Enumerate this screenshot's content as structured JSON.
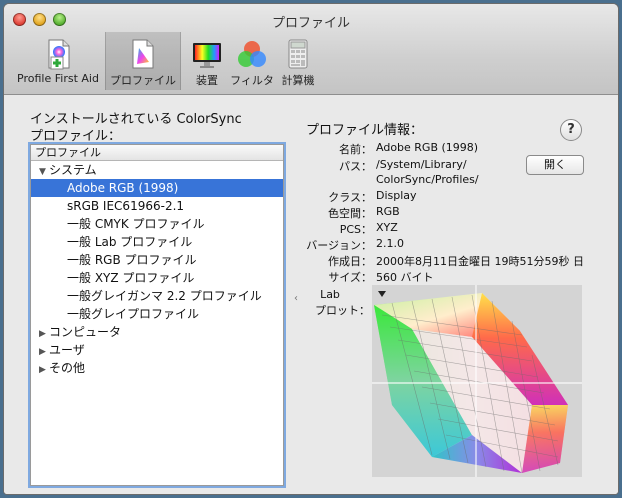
{
  "window": {
    "title": "プロファイル"
  },
  "toolbar": {
    "items": [
      {
        "label": "Profile First Aid",
        "icon": "profile-first-aid-icon"
      },
      {
        "label": "プロファイル",
        "icon": "profile-document-icon",
        "selected": true
      },
      {
        "label": "装置",
        "icon": "display-icon"
      },
      {
        "label": "フィルタ",
        "icon": "color-filter-icon"
      },
      {
        "label": "計算機",
        "icon": "calculator-icon"
      }
    ]
  },
  "left": {
    "heading_line1": "インストールされている ColorSync",
    "heading_line2": "プロファイル：",
    "list_header": "プロファイル",
    "groups": [
      {
        "label": "システム",
        "expanded": true,
        "items": [
          "Adobe RGB (1998)",
          "sRGB IEC61966-2.1",
          "一般 CMYK プロファイル",
          "一般 Lab プロファイル",
          "一般 RGB プロファイル",
          "一般 XYZ プロファイル",
          "一般グレイガンマ 2.2 プロファイル",
          "一般グレイプロファイル"
        ]
      },
      {
        "label": "コンピュータ",
        "expanded": false
      },
      {
        "label": "ユーザ",
        "expanded": false
      },
      {
        "label": "その他",
        "expanded": false
      }
    ],
    "selected_item": "Adobe RGB (1998)"
  },
  "info": {
    "heading": "プロファイル情報：",
    "help_label": "?",
    "open_button": "開く",
    "fields": {
      "name_label": "名前：",
      "name_value": "Adobe RGB (1998)",
      "path_label": "パス：",
      "path_line1": "/System/Library/",
      "path_line2": "ColorSync/Profiles/",
      "class_label": "クラス：",
      "class_value": "Display",
      "space_label": "色空間：",
      "space_value": "RGB",
      "pcs_label": "PCS：",
      "pcs_value": "XYZ",
      "version_label": "バージョン：",
      "version_value": "2.1.0",
      "created_label": "作成日：",
      "created_value": "2000年8月11日金曜日 19時51分59秒 日",
      "size_label": "サイズ：",
      "size_value": "560 バイト"
    },
    "plot_label_line1": "Lab",
    "plot_label_line2": "プロット："
  }
}
